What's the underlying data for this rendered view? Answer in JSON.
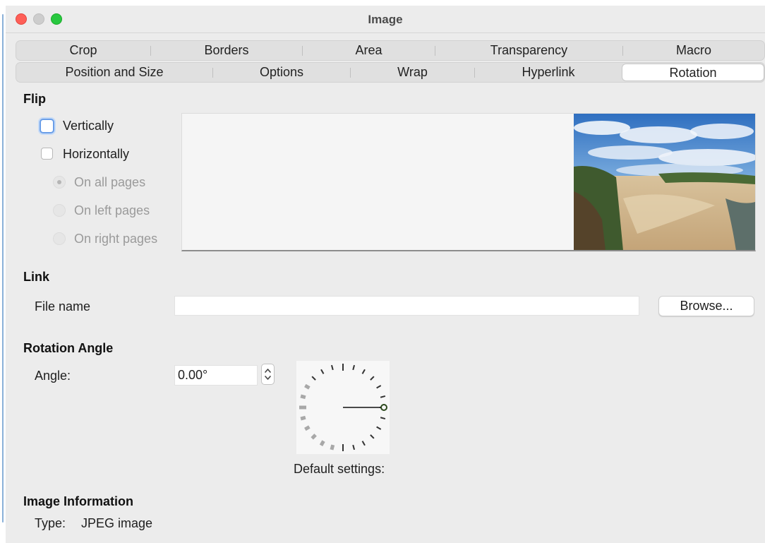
{
  "window": {
    "title": "Image"
  },
  "tabs_row1": [
    "Crop",
    "Borders",
    "Area",
    "Transparency",
    "Macro"
  ],
  "tabs_row2": [
    "Position and Size",
    "Options",
    "Wrap",
    "Hyperlink",
    "Rotation"
  ],
  "selected_tab": "Rotation",
  "flip": {
    "heading": "Flip",
    "vertically_label": "Vertically",
    "vertically_checked": false,
    "horizontally_label": "Horizontally",
    "horizontally_checked": false,
    "pages": [
      {
        "label": "On all pages",
        "selected": true,
        "enabled": false
      },
      {
        "label": "On left pages",
        "selected": false,
        "enabled": false
      },
      {
        "label": "On right pages",
        "selected": false,
        "enabled": false
      }
    ]
  },
  "link": {
    "heading": "Link",
    "file_name_label": "File name",
    "file_name_value": "",
    "browse_label": "Browse..."
  },
  "rotation": {
    "heading": "Rotation Angle",
    "angle_label": "Angle:",
    "angle_value": "0.00°",
    "default_settings_label": "Default settings:"
  },
  "image_info": {
    "heading": "Image Information",
    "type_label": "Type:",
    "type_value": "JPEG image"
  },
  "colors": {
    "close": "#fe5f57",
    "minimize": "#cdcdcd",
    "zoom": "#28c840",
    "focus_ring": "#6a9ee8"
  }
}
